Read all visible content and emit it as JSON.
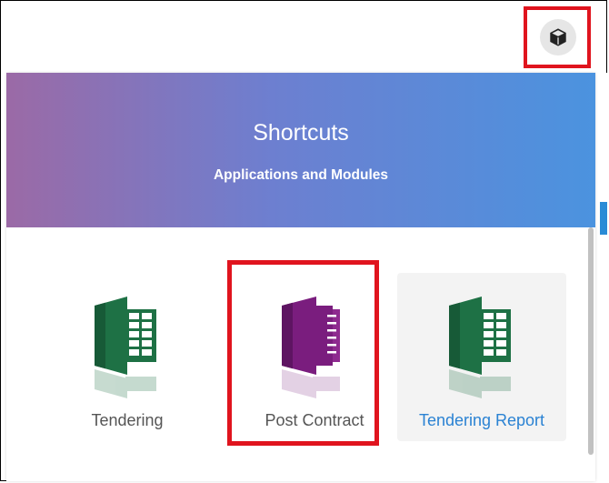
{
  "header": {
    "app_button_icon": "cube-icon"
  },
  "shortcuts": {
    "title": "Shortcuts",
    "subtitle": "Applications and Modules",
    "tiles": [
      {
        "label": "Tendering",
        "icon": "spreadsheet-icon",
        "color": "#1e7145"
      },
      {
        "label": "Post Contract",
        "icon": "document-icon",
        "color": "#7a1d7e"
      },
      {
        "label": "Tendering Report",
        "icon": "spreadsheet-icon",
        "color": "#1e7145"
      }
    ]
  },
  "colors": {
    "highlight": "#e0141e",
    "header_gradient_start": "#9b6aa6",
    "header_gradient_end": "#4b93df",
    "link_blue": "#2a82d3"
  }
}
